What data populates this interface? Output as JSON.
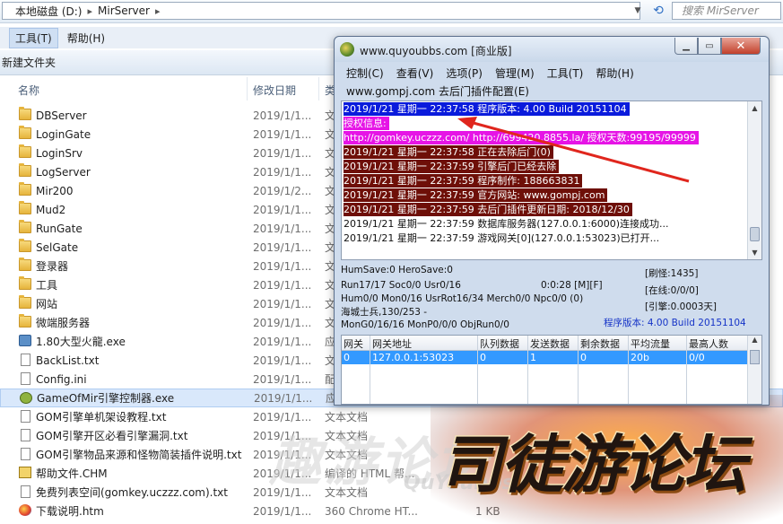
{
  "explorer": {
    "address": {
      "drive": "本地磁盘 (D:)",
      "folder": "MirServer"
    },
    "search_placeholder": "搜索 MirServer",
    "menu": [
      "工具(T)",
      "帮助(H)"
    ],
    "new_folder": "新建文件夹",
    "columns": {
      "name": "名称",
      "date": "修改日期",
      "type": "类",
      "size": "大"
    },
    "files": [
      {
        "name": "DBServer",
        "date": "2019/1/1...",
        "type": "文",
        "kind": "folder"
      },
      {
        "name": "LoginGate",
        "date": "2019/1/1...",
        "type": "文",
        "kind": "folder"
      },
      {
        "name": "LoginSrv",
        "date": "2019/1/1...",
        "type": "文",
        "kind": "folder"
      },
      {
        "name": "LogServer",
        "date": "2019/1/1...",
        "type": "文",
        "kind": "folder"
      },
      {
        "name": "Mir200",
        "date": "2019/1/2...",
        "type": "文",
        "kind": "folder"
      },
      {
        "name": "Mud2",
        "date": "2019/1/1...",
        "type": "文",
        "kind": "folder"
      },
      {
        "name": "RunGate",
        "date": "2019/1/1...",
        "type": "文",
        "kind": "folder"
      },
      {
        "name": "SelGate",
        "date": "2019/1/1...",
        "type": "文",
        "kind": "folder"
      },
      {
        "name": "登录器",
        "date": "2019/1/1...",
        "type": "文",
        "kind": "folder"
      },
      {
        "name": "工具",
        "date": "2019/1/1...",
        "type": "文",
        "kind": "folder"
      },
      {
        "name": "网站",
        "date": "2019/1/1...",
        "type": "文",
        "kind": "folder"
      },
      {
        "name": "微端服务器",
        "date": "2019/1/1...",
        "type": "文",
        "kind": "folder"
      },
      {
        "name": "1.80大型火龍.exe",
        "date": "2019/1/1...",
        "type": "应",
        "kind": "exe"
      },
      {
        "name": "BackList.txt",
        "date": "2019/1/1...",
        "type": "文",
        "kind": "doc"
      },
      {
        "name": "Config.ini",
        "date": "2019/1/1...",
        "type": "配",
        "kind": "doc"
      },
      {
        "name": "GameOfMir引擎控制器.exe",
        "date": "2019/1/1...",
        "type": "应",
        "kind": "exe2"
      },
      {
        "name": "GOM引擎单机架设教程.txt",
        "date": "2019/1/1...",
        "type": "文本文档",
        "kind": "doc"
      },
      {
        "name": "GOM引擎开区必看引擎漏洞.txt",
        "date": "2019/1/1...",
        "type": "文本文档",
        "kind": "doc"
      },
      {
        "name": "GOM引擎物品来源和怪物简装插件说明.txt",
        "date": "2019/1/1...",
        "type": "文本文档",
        "kind": "doc"
      },
      {
        "name": "帮助文件.CHM",
        "date": "2019/1/1...",
        "type": "编译的 HTML 帮...",
        "kind": "chm"
      },
      {
        "name": "免费列表空间(gomkey.uczzz.com).txt",
        "date": "2019/1/1...",
        "type": "文本文档",
        "kind": "doc"
      },
      {
        "name": "下载说明.htm",
        "date": "2019/1/1...",
        "type": "360 Chrome HT...",
        "size": "1 KB",
        "kind": "htm"
      }
    ]
  },
  "dialog": {
    "title": "www.quyoubbs.com [商业版]",
    "menu": [
      "控制(C)",
      "查看(V)",
      "选项(P)",
      "管理(M)",
      "工具(T)",
      "帮助(H)"
    ],
    "menu2": "www.gompj.com 去后门插件配置(E)",
    "log": [
      {
        "text": "2019/1/21 星期一 22:37:58 程序版本: 4.00 Build 20151104",
        "style": "blue"
      },
      {
        "text": "授权信息:",
        "style": "mag"
      },
      {
        "text": "http://gomkey.uczzz.com/ http://699420.8855.la/ 授权天数:99195/99999",
        "style": "mag"
      },
      {
        "text": "2019/1/21 星期一 22:37:58 正在去除后门(0)",
        "style": "dark"
      },
      {
        "text": "2019/1/21 星期一 22:37:59 引擎后门已经去除",
        "style": "dark"
      },
      {
        "text": "2019/1/21 星期一 22:37:59 程序制作: 188663831",
        "style": "dark"
      },
      {
        "text": "2019/1/21 星期一 22:37:59 官方网站: www.gompj.com",
        "style": "dark"
      },
      {
        "text": "2019/1/21 星期一 22:37:59 去后门插件更新日期: 2018/12/30",
        "style": "dark"
      },
      {
        "text": "2019/1/21 星期一 22:37:59 数据库服务器(127.0.0.1:6000)连接成功...",
        "style": "plain"
      },
      {
        "text": "2019/1/21 星期一 22:37:59 游戏网关[0](127.0.0.1:53023)已打开...",
        "style": "plain"
      }
    ],
    "status": {
      "hum": "HumSave:0 HeroSave:0",
      "run": "Run17/17 Soc0/0 Usr0/16",
      "time": "0:0:28 [M][F]",
      "refresh": "[刷怪:1435]",
      "online": "[在线:0/0/0]",
      "engine": "[引擎:0.0003天]",
      "mon": "Hum0/0 Mon0/16 UsrRot16/34 Merch0/0 Npc0/0 (0)",
      "soldier": "海城士兵,130/253 -",
      "mong": "MonG0/16/16 MonP0/0/0 ObjRun0/0",
      "version": "程序版本: 4.00 Build 20151104"
    },
    "grid": {
      "headers": [
        "网关",
        "网关地址",
        "队列数据",
        "发送数据",
        "剩余数据",
        "平均流量",
        "最高人数"
      ],
      "row": [
        "0",
        "127.0.0.1:53023",
        "0",
        "1",
        "0",
        "20b",
        "0/0"
      ]
    }
  },
  "watermark": {
    "main": "司徒游论坛",
    "faint": "趣游论坛",
    "faint_latin": "QuYoubbs"
  }
}
